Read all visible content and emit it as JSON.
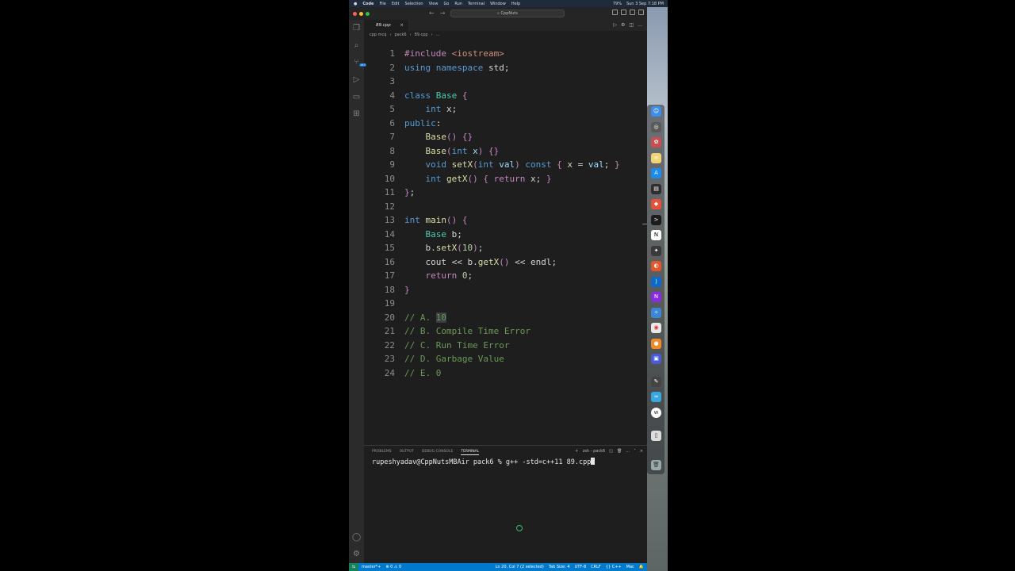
{
  "menubar": {
    "app": "Code",
    "items": [
      "File",
      "Edit",
      "Selection",
      "View",
      "Go",
      "Run",
      "Terminal",
      "Window",
      "Help"
    ],
    "clock": "Sun 3 Sep 7:18 PM",
    "battery": "79%"
  },
  "titlebar": {
    "search": "CppNuts"
  },
  "activity": {
    "source_control_badge": "163"
  },
  "tab": {
    "label": "89.cpp",
    "close": "×"
  },
  "breadcrumb": [
    "cpp mcq",
    "pack6",
    "89.cpp",
    "..."
  ],
  "editor": {
    "lines": [
      {
        "n": "1",
        "t": "#include <iostream>"
      },
      {
        "n": "2",
        "t": "using namespace std;"
      },
      {
        "n": "3",
        "t": ""
      },
      {
        "n": "4",
        "t": "class Base {"
      },
      {
        "n": "5",
        "t": "    int x;"
      },
      {
        "n": "6",
        "t": "public:"
      },
      {
        "n": "7",
        "t": "    Base() {}"
      },
      {
        "n": "8",
        "t": "    Base(int x) {}"
      },
      {
        "n": "9",
        "t": "    void setX(int val) const { x = val; }"
      },
      {
        "n": "10",
        "t": "    int getX() { return x; }"
      },
      {
        "n": "11",
        "t": "};"
      },
      {
        "n": "12",
        "t": ""
      },
      {
        "n": "13",
        "t": "int main() {"
      },
      {
        "n": "14",
        "t": "    Base b;"
      },
      {
        "n": "15",
        "t": "    b.setX(10);"
      },
      {
        "n": "16",
        "t": "    cout << b.getX() << endl;"
      },
      {
        "n": "17",
        "t": "    return 0;"
      },
      {
        "n": "18",
        "t": "}"
      },
      {
        "n": "19",
        "t": ""
      },
      {
        "n": "20",
        "t": "// A. 10"
      },
      {
        "n": "21",
        "t": "// B. Compile Time Error"
      },
      {
        "n": "22",
        "t": "// C. Run Time Error"
      },
      {
        "n": "23",
        "t": "// D. Garbage Value"
      },
      {
        "n": "24",
        "t": "// E. 0"
      }
    ]
  },
  "panel": {
    "tabs": [
      "PROBLEMS",
      "OUTPUT",
      "DEBUG CONSOLE",
      "TERMINAL"
    ],
    "active_tab": "TERMINAL",
    "shell": "zsh - pack6",
    "terminal_line": "rupeshyadav@CppNutsMBAir pack6 % g++ -std=c++11 89.cpp"
  },
  "statusbar": {
    "branch": "master*+",
    "problems": "⊗ 0 ⚠ 0",
    "position": "Ln 20, Col 7 (2 selected)",
    "tab_size": "Tab Size: 4",
    "encoding": "UTF-8",
    "eol": "CRLF",
    "language": "{} C++",
    "platform": "Mac"
  },
  "colors": {
    "accent": "#007acc",
    "editor_bg": "#1e1e1e",
    "keyword": "#569cd6",
    "control": "#c586c0",
    "type": "#4ec9b0",
    "function": "#dcdcaa",
    "comment": "#6a9955",
    "number": "#b5cea8"
  }
}
